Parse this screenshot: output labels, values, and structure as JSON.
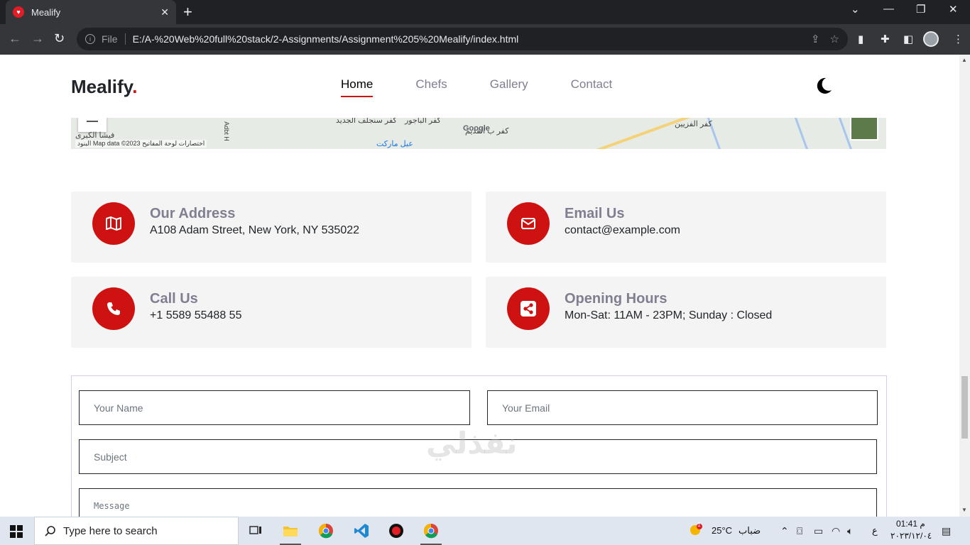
{
  "browser": {
    "tab_title": "Mealify",
    "new_tab": "+",
    "close": "✕",
    "file_label": "File",
    "url": "E:/A-%20Web%20full%20stack/2-Assignments/Assignment%205%20Mealify/index.html"
  },
  "site": {
    "logo": "Mealify",
    "logo_dot": ".",
    "nav": [
      "Home",
      "Chefs",
      "Gallery",
      "Contact"
    ],
    "map": {
      "labels": [
        "كفر سنجلف الجديد",
        "كفر الباجور",
        "كفر ب القديم",
        "كفر الفزيين",
        "عبل ماركت",
        "فيشا الكبرى",
        "Adbt H"
      ],
      "credit": "Map data ©2023",
      "shortcuts": "اختصارات لوحة المفاتيح",
      "terms": "البنود",
      "google": "Google"
    },
    "info": [
      {
        "title": "Our Address",
        "value": "A108 Adam Street, New York, NY 535022",
        "icon": "map-icon"
      },
      {
        "title": "Email Us",
        "value": "contact@example.com",
        "icon": "envelope-icon"
      },
      {
        "title": "Call Us",
        "value": "+1 5589 55488 55",
        "icon": "phone-icon"
      },
      {
        "title": "Opening Hours",
        "value": "Mon-Sat: 11AM - 23PM; Sunday : Closed",
        "icon": "share-icon"
      }
    ],
    "form": {
      "name_placeholder": "Your Name",
      "email_placeholder": "Your Email",
      "subject_placeholder": "Subject",
      "message_placeholder": "Message"
    },
    "watermark": "نفذلي"
  },
  "taskbar": {
    "search_placeholder": "Type here to search",
    "temperature": "25°C",
    "weather": "ضباب",
    "lang": "ع",
    "time": "01:41 م",
    "date": "٢٠٢٣/١٢/٠٤",
    "weather_badge": "1"
  },
  "colors": {
    "accent": "#ce1212",
    "tab_bg": "#35363a",
    "chrome_bg": "#202124"
  }
}
